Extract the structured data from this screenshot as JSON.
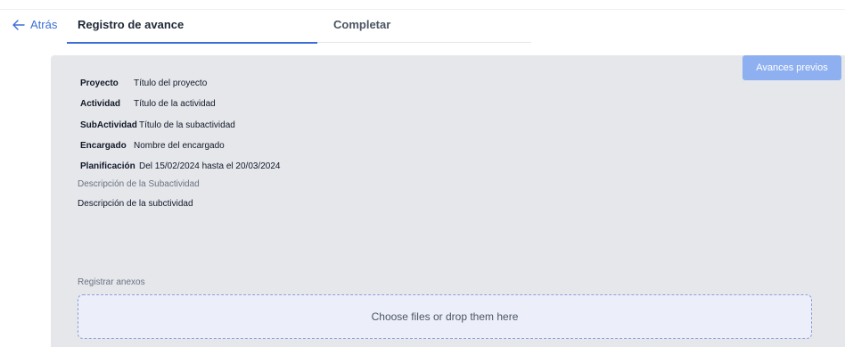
{
  "header": {
    "back_label": "Atrás",
    "tabs": [
      {
        "label": "Registro de avance",
        "active": true
      },
      {
        "label": "Completar",
        "active": false
      }
    ]
  },
  "panel": {
    "prev_button_label": "Avances previos",
    "fields": {
      "proyecto": {
        "label": "Proyecto",
        "value": "Título del proyecto"
      },
      "actividad": {
        "label": "Actividad",
        "value": "Título de la actividad"
      },
      "subactividad": {
        "label": "SubActividad",
        "value": "Título de la subactividad"
      },
      "encargado": {
        "label": "Encargado",
        "value": "Nombre del encargado"
      },
      "planificacion": {
        "label": "Planificación",
        "value": "Del 15/02/2024 hasta el 20/03/2024"
      }
    },
    "description_label": "Descripción de la Subactividad",
    "description_text": "Descripción de la subctividad",
    "annex_label": "Registrar anexos",
    "dropzone_text": "Choose files or drop them here"
  },
  "colors": {
    "accent": "#3b6fd6",
    "button": "#8fb0f0",
    "panel_bg": "#e5e7eb",
    "dropzone_bg": "#eceefa"
  }
}
